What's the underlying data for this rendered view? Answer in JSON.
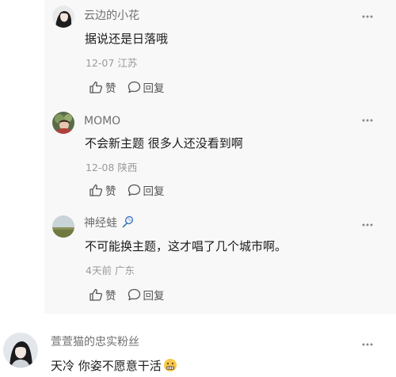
{
  "comments": [
    {
      "username": "云边的小花",
      "text": "据说还是日落哦",
      "date": "12-07",
      "location": "江苏",
      "like_label": "赞",
      "reply_label": "回复"
    },
    {
      "username": "MOMO",
      "text": "不会新主题 很多人还没看到啊",
      "date": "12-08",
      "location": "陕西",
      "like_label": "赞",
      "reply_label": "回复"
    },
    {
      "username": "神经蛙",
      "text": "不可能换主题，这才唱了几个城市啊。",
      "date": "4天前",
      "location": "广东",
      "like_label": "赞",
      "reply_label": "回复"
    },
    {
      "username": "萱萱猫的忠实粉丝",
      "text": "天冷 你姿不愿意干活",
      "date": "",
      "location": "",
      "like_label": "",
      "reply_label": ""
    }
  ],
  "icons": {
    "like": "thumbs-up-icon",
    "reply": "speech-bubble-icon",
    "more": "more-dots-icon",
    "badge": "racket-badge-icon",
    "emoji": "grimacing-emoji-icon"
  },
  "colors": {
    "text_primary": "#1a1a1a",
    "username": "#6f6f6f",
    "meta": "#9a9a9a",
    "nested_background": "#f8f8f8"
  }
}
